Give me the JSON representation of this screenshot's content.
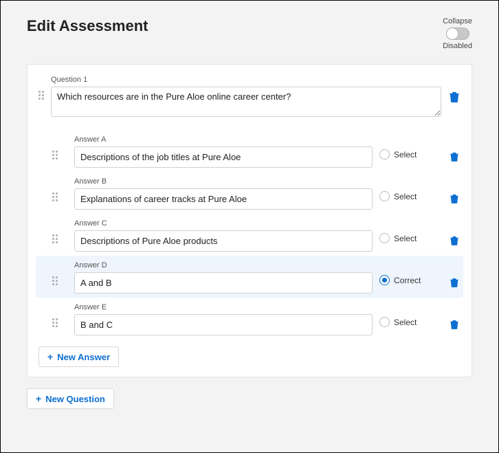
{
  "header": {
    "title": "Edit Assessment",
    "collapse": {
      "label": "Collapse",
      "state": "Disabled"
    }
  },
  "question": {
    "label": "Question 1",
    "text": "Which resources are in the Pure Aloe online career center?"
  },
  "answers": [
    {
      "letter": "A",
      "label": "Answer A",
      "text": "Descriptions of the job titles at Pure Aloe",
      "correct": false
    },
    {
      "letter": "B",
      "label": "Answer B",
      "text": "Explanations of career tracks at Pure Aloe",
      "correct": false
    },
    {
      "letter": "C",
      "label": "Answer C",
      "text": "Descriptions of Pure Aloe products",
      "correct": false
    },
    {
      "letter": "D",
      "label": "Answer D",
      "text": "A and B",
      "correct": true
    },
    {
      "letter": "E",
      "label": "Answer E",
      "text": "B and C",
      "correct": false
    }
  ],
  "labels": {
    "select": "Select",
    "correct": "Correct",
    "newAnswer": "New Answer",
    "newQuestion": "New Question"
  }
}
